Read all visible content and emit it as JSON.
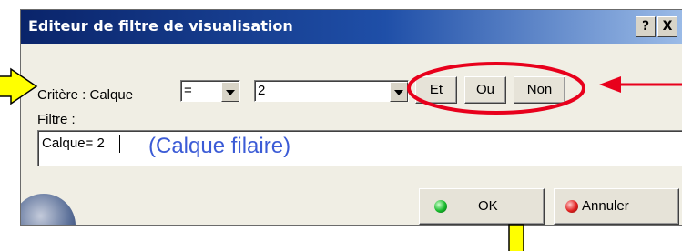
{
  "dialog": {
    "title": "Editeur de filtre de visualisation",
    "help_button": "?",
    "close_button": "X"
  },
  "criteria": {
    "label": "Critère : Calque",
    "operator_value": "=",
    "value": "2",
    "buttons": [
      "Et",
      "Ou",
      "Non"
    ]
  },
  "filter": {
    "label": "Filtre :",
    "value": "Calque= 2"
  },
  "annotation": {
    "text": "(Calque filaire)",
    "color": "#3b5bd6"
  },
  "footer": {
    "ok_label": "OK",
    "cancel_label": "Annuler"
  },
  "colors": {
    "highlight_ellipse": "#e8001c",
    "arrow_red": "#e8001c",
    "arrow_yellow": "#ffff00",
    "title_bar": "#0a246a"
  }
}
